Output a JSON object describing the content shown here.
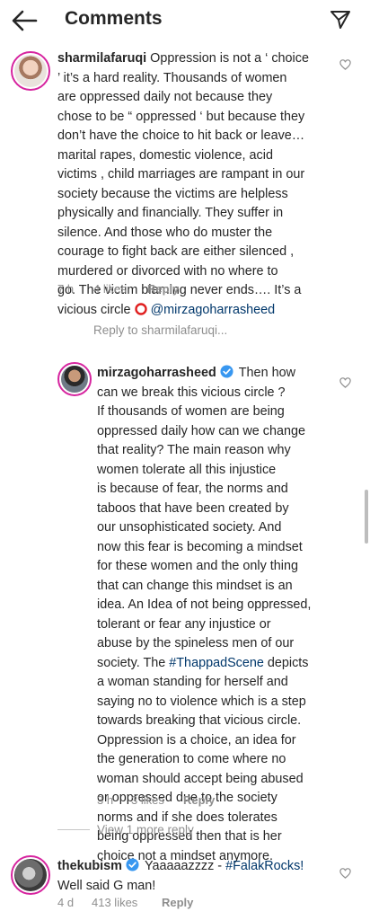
{
  "header": {
    "title": "Comments",
    "back_icon": "arrow-left-icon",
    "send_icon": "paper-plane-icon"
  },
  "comments": [
    {
      "username": "sharmilafaruqi",
      "lines": [
        "Oppression is not a ‘ choice",
        "’ it’s a hard reality. Thousands of women",
        "are oppressed daily not because they",
        "chose to be “ oppressed ‘ but because they",
        "don’t have the choice to hit back or leave…",
        "marital rapes, domestic violence, acid",
        "victims , child marriages are rampant in our",
        "society because the victims are helpless",
        "physically and financially. They suffer in",
        "silence.  And those who do muster the",
        "courage to fight back  are either silenced ,",
        "murdered or divorced  with no where to",
        "go. The victim blaming never ends…. It’s a",
        "vicious circle"
      ],
      "mention": "@mirzagoharrasheed",
      "time": "7 h",
      "likes": "4 likes",
      "reply": "Reply"
    },
    {
      "reply_to": "Reply to sharmilafaruqi..."
    },
    {
      "username": "mirzagoharrasheed",
      "lines": [
        "Then how",
        "can we break this vicious circle ?",
        "If thousands of women are being",
        "oppressed daily how can we change",
        "that reality? The main reason why",
        "women tolerate all this injustice",
        "is because of fear, the norms and",
        "taboos that have been created by",
        "our unsophisticated society. And",
        "now this fear is becoming a mindset",
        "for these women and the only thing",
        "that can change this mindset is an",
        "idea. An Idea of not being oppressed,",
        "tolerant or fear any injustice or",
        "abuse by the spineless men of our",
        "society. The",
        "a woman standing for herself and",
        "saying no to violence which is a step",
        "towards breaking that vicious circle.",
        "Oppression is a choice, an idea for",
        "the generation to come where no",
        "woman should accept being abused",
        "or oppressed due to the society",
        "norms and if she does tolerates",
        "being oppressed then that is her",
        "choice not a mindset anymore."
      ],
      "hashtag": "#ThappadScene",
      "line16_tail": "depicts",
      "time": "3 h",
      "likes": "3 likes",
      "reply": "Reply"
    },
    {
      "view_more": "View 1 more reply"
    },
    {
      "username": "thekubism",
      "text_before": "Yaaaaazzzz -",
      "hashtag": "#FalakRocks!",
      "line2": "Well said G man!",
      "time": "4 d",
      "likes": "413 likes",
      "reply": "Reply"
    }
  ]
}
